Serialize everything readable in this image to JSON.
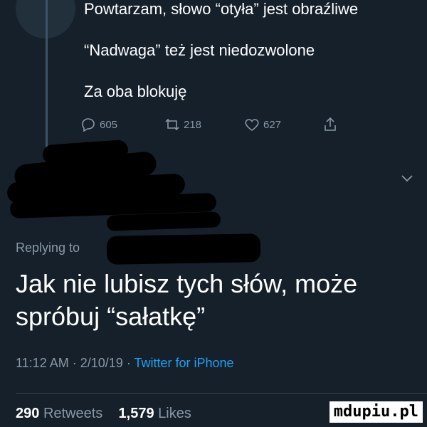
{
  "parent_tweet": {
    "lines": [
      "Powtarzam, słowo “otyła” jest obraźliwe",
      "“Nadwaga” też jest niedozwolone",
      "Za oba blokuję"
    ],
    "actions": {
      "replies": "605",
      "retweets": "218",
      "likes": "627"
    }
  },
  "replying_to": "Replying to",
  "main_tweet": {
    "text": "Jak nie lubisz tych słów, może spróbuj “sałatkę”",
    "time": "11:12 AM",
    "date": "2/10/19",
    "client": "Twitter for iPhone"
  },
  "stats": {
    "retweets_count": "290",
    "retweets_label": "Retweets",
    "likes_count": "1,579",
    "likes_label": "Likes"
  },
  "watermark": "mdupiu.pl",
  "colors": {
    "background": "#15202b",
    "secondary_text": "#8899a6",
    "accent": "#1da1f2"
  }
}
